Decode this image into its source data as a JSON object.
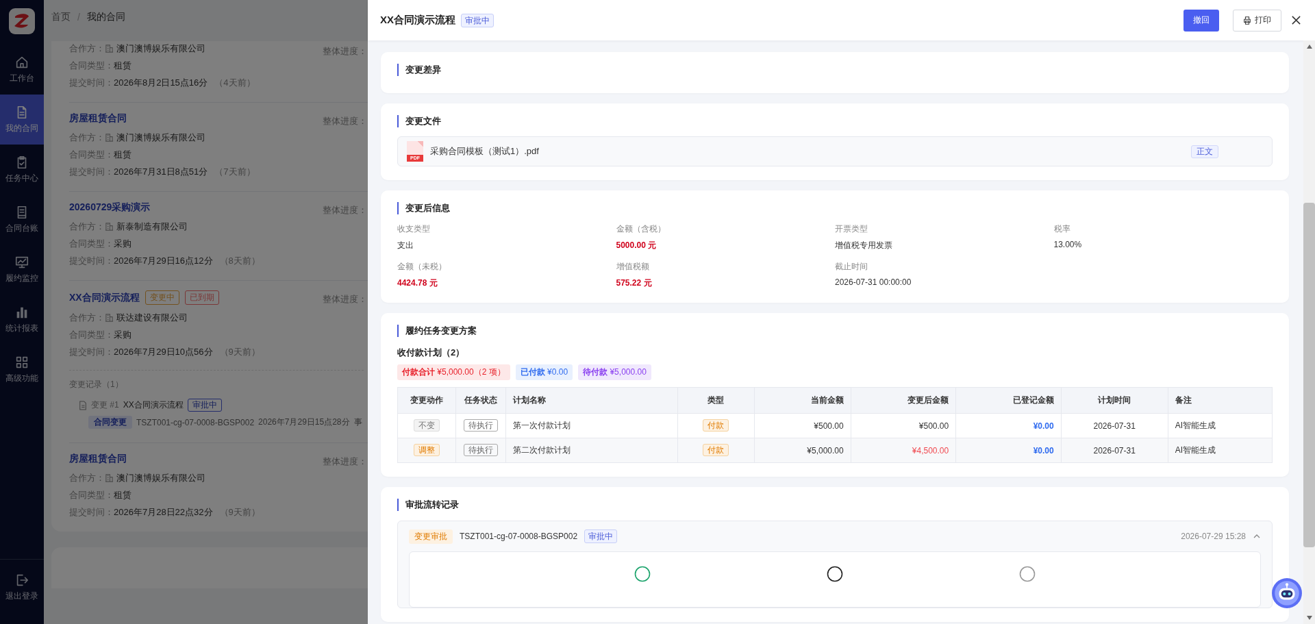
{
  "sidebar": {
    "items": [
      {
        "label": "工作台",
        "selected": false
      },
      {
        "label": "我的合同",
        "selected": true
      },
      {
        "label": "任务中心",
        "selected": false
      },
      {
        "label": "合同台账",
        "selected": false
      },
      {
        "label": "履约监控",
        "selected": false
      },
      {
        "label": "统计报表",
        "selected": false
      },
      {
        "label": "高级功能",
        "selected": false
      }
    ],
    "logout": {
      "label": "退出登录"
    }
  },
  "breadcrumb": {
    "items": [
      "首页",
      "我的合同"
    ],
    "separator": "/"
  },
  "contracts": [
    {
      "fields": [
        {
          "label": "合作方：",
          "value": "澳门澳博娱乐有限公司",
          "kind": "partner"
        },
        {
          "label": "合同类型：",
          "value": "租赁",
          "kind": "plain"
        },
        {
          "label": "提交时间：",
          "value": "2026年8月2日15点16分",
          "note": "（4天前）",
          "kind": "plain"
        }
      ],
      "progress_label": "整体进度："
    },
    {
      "title": "房屋租赁合同",
      "fields": [
        {
          "label": "合作方：",
          "value": "澳门澳博娱乐有限公司",
          "kind": "partner"
        },
        {
          "label": "合同类型：",
          "value": "租赁",
          "kind": "plain"
        },
        {
          "label": "提交时间：",
          "value": "2026年7月31日8点51分",
          "note": "（7天前）",
          "kind": "plain"
        }
      ],
      "progress_label": "整体进度："
    },
    {
      "title": "20260729采购演示",
      "fields": [
        {
          "label": "合作方：",
          "value": "新泰制造有限公司",
          "kind": "partner"
        },
        {
          "label": "合同类型：",
          "value": "采购",
          "kind": "plain"
        },
        {
          "label": "提交时间：",
          "value": "2026年7月29日16点12分",
          "note": "（8天前）",
          "kind": "plain"
        }
      ],
      "progress_label": "整体进度："
    },
    {
      "title": "XX合同演示流程",
      "tags": [
        {
          "label": "变更中",
          "kind": "changing"
        },
        {
          "label": "已到期",
          "kind": "expired"
        }
      ],
      "fields": [
        {
          "label": "合作方：",
          "value": "联达建设有限公司",
          "kind": "partner"
        },
        {
          "label": "合同类型：",
          "value": "采购",
          "kind": "plain"
        },
        {
          "label": "提交时间：",
          "value": "2026年7月29日10点56分",
          "note": "（9天前）",
          "kind": "plain"
        }
      ],
      "progress_label": "整体进度：",
      "changes": {
        "heading": "变更记录（1）",
        "items": [
          {
            "index": "变更 #1",
            "name": "XX合同演示流程",
            "status": "审批中",
            "tag": "合同变更",
            "code": "TSZT001-cg-07-0008-BGSP002",
            "time": "2026年7月29日15点28分",
            "extra": "事"
          }
        ]
      }
    },
    {
      "title": "房屋租赁合同",
      "fields": [
        {
          "label": "合作方：",
          "value": "澳门澳博娱乐有限公司",
          "kind": "partner"
        },
        {
          "label": "合同类型：",
          "value": "租赁",
          "kind": "plain"
        },
        {
          "label": "提交时间：",
          "value": "2026年7月28日22点32分",
          "note": "（9天前）",
          "kind": "plain"
        }
      ],
      "progress_label": "整体进度："
    }
  ],
  "drawer": {
    "title": "XX合同演示流程",
    "status": "审批中",
    "actions": [
      {
        "label": "撤回",
        "kind": "primary"
      },
      {
        "label": "打印",
        "kind": "print"
      }
    ],
    "sections": [
      {
        "kind": "empty",
        "title": "变更差异"
      },
      {
        "kind": "files",
        "title": "变更文件",
        "files": [
          {
            "badge": "PDF",
            "name": "采购合同模板（测试1）.pdf",
            "tag": "正文"
          }
        ]
      },
      {
        "kind": "info",
        "title": "变更后信息",
        "fields": [
          {
            "label": "收支类型",
            "value": "支出",
            "highlight": false
          },
          {
            "label": "金额（含税）",
            "value": "5000.00 元",
            "highlight": true
          },
          {
            "label": "开票类型",
            "value": "增值税专用发票",
            "highlight": false
          },
          {
            "label": "税率",
            "value": "13.00%",
            "highlight": false
          },
          {
            "label": "金额（未税）",
            "value": "4424.78 元",
            "highlight": true
          },
          {
            "label": "增值税额",
            "value": "575.22 元",
            "highlight": true
          },
          {
            "label": "截止时间",
            "value": "2026-07-31 00:00:00",
            "highlight": false
          }
        ]
      },
      {
        "kind": "plan",
        "title": "履约任务变更方案",
        "subtitle": "收付款计划（2）",
        "summary": [
          {
            "label": "付款合计",
            "value": "¥5,000.00（2 项）",
            "color": "#e8202a"
          },
          {
            "label": "已付款",
            "value": "¥0.00",
            "color": "#2f6bef"
          },
          {
            "label": "待付款",
            "value": "¥5,000.00",
            "color": "#8a3ff0"
          }
        ],
        "columns": [
          "变更动作",
          "任务状态",
          "计划名称",
          "类型",
          "当前金额",
          "变更后金额",
          "已登记金额",
          "计划时间",
          "备注"
        ],
        "rows": [
          {
            "action": {
              "label": "不变",
              "kind": "keep"
            },
            "status": "待执行",
            "name": "第一次付款计划",
            "type": "付款",
            "current": "¥500.00",
            "after": {
              "value": "¥500.00",
              "changed": false
            },
            "registered": "¥0.00",
            "date": "2026-07-31",
            "note": "AI智能生成"
          },
          {
            "action": {
              "label": "调整",
              "kind": "adjust"
            },
            "status": "待执行",
            "name": "第二次付款计划",
            "type": "付款",
            "current": "¥5,000.00",
            "after": {
              "value": "¥4,500.00",
              "changed": true
            },
            "registered": "¥0.00",
            "date": "2026-07-31",
            "note": "AI智能生成"
          }
        ]
      },
      {
        "kind": "approval",
        "title": "审批流转记录",
        "records": [
          {
            "tag": "变更审批",
            "code": "TSZT001-cg-07-0008-BGSP002",
            "status": "审批中",
            "time": "2026-07-29 15:28",
            "expanded": true
          }
        ]
      }
    ]
  }
}
